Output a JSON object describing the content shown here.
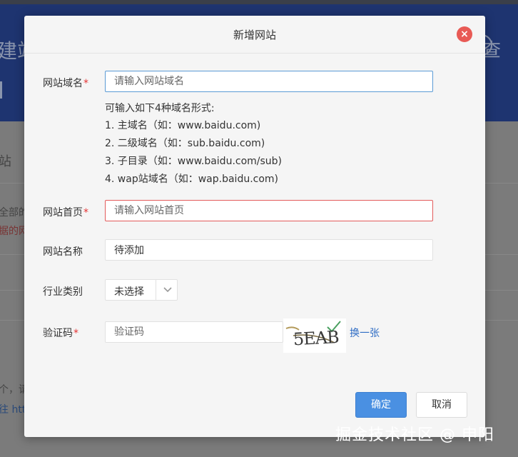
{
  "background": {
    "header_title": "建站",
    "header_right": "查",
    "section_title": "站",
    "text_lines": [
      "全部的",
      "据的网",
      "个，请",
      "往 htt"
    ]
  },
  "modal": {
    "title": "新增网站",
    "close_symbol": "×",
    "fields": {
      "domain": {
        "label": "网站域名",
        "required": "*",
        "placeholder": "请输入网站域名",
        "value": ""
      },
      "homepage": {
        "label": "网站首页",
        "required": "*",
        "placeholder": "请输入网站首页",
        "value": ""
      },
      "name": {
        "label": "网站名称",
        "placeholder": "",
        "value": "待添加"
      },
      "industry": {
        "label": "行业类别",
        "selected": "未选择"
      },
      "captcha": {
        "label": "验证码",
        "required": "*",
        "placeholder": "验证码",
        "value": "",
        "image_text": "5EAB",
        "refresh_label": "换一张"
      }
    },
    "domain_hints": [
      "可输入如下4种域名形式:",
      "1. 主域名（如：www.baidu.com)",
      "2. 二级域名（如：sub.baidu.com)",
      "3. 子目录（如：www.baidu.com/sub)",
      "4. wap站域名（如：wap.baidu.com)"
    ],
    "buttons": {
      "confirm": "确定",
      "cancel": "取消"
    }
  },
  "watermark": "掘金技术社区 @ 申阳",
  "colors": {
    "primary": "#4a90e2",
    "required": "#e53333",
    "close": "#e85a55",
    "link": "#2e6cc4",
    "header_bg": "#1e3470"
  }
}
